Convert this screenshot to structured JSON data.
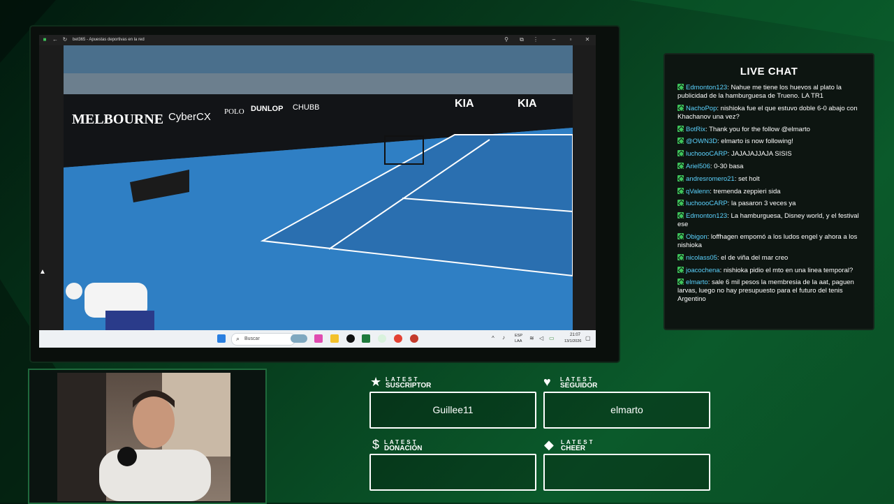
{
  "browser": {
    "title": "bet365 - Apuestas deportivas en la red"
  },
  "video": {
    "ads": [
      "MELBOURNE",
      "CyberCX",
      "POLO",
      "DUNLOP",
      "CHUBB",
      "KIA",
      "KIA"
    ]
  },
  "taskbar": {
    "search_placeholder": "Buscar",
    "lang": "ESP",
    "lang_sub": "LAA",
    "time": "21:07",
    "date": "13/1/2026"
  },
  "chat": {
    "title": "LIVE CHAT",
    "messages": [
      {
        "user": "Edmonton123",
        "text": "Nahue me tiene los huevos al plato la publicidad de la hamburguesa de Trueno. LA TR1"
      },
      {
        "user": "NachoPop",
        "text": "nishioka fue el que estuvo doble 6-0 abajo con Khachanov una vez?"
      },
      {
        "user": "BotRix",
        "text": "Thank you for the follow @elmarto"
      },
      {
        "user": "@OWN3D",
        "text": "elmarto is now following!"
      },
      {
        "user": "luchoooCARP",
        "text": "JAJAJAJJAJA SISIS"
      },
      {
        "user": "Ariel506",
        "text": "0-30 basa"
      },
      {
        "user": "andresromero21",
        "text": "set holt"
      },
      {
        "user": "qValenn",
        "text": "tremenda zeppieri sida"
      },
      {
        "user": "luchoooCARP",
        "text": "la pasaron 3 veces ya"
      },
      {
        "user": "Edmonton123",
        "text": "La hamburguesa, Disney world, y el festival ese"
      },
      {
        "user": "Obigon",
        "text": "loffhagen empomó a los ludos engel y ahora a los nishioka"
      },
      {
        "user": "nicolass05",
        "text": "el de viña del mar creo"
      },
      {
        "user": "joacochena",
        "text": "nishioka pidio el mto en una linea temporal?"
      },
      {
        "user": "elmarto",
        "text": "sale 6 mil pesos la membresia de la aat, paguen larvas, luego no hay presupuesto para el futuro del tenis Argentino"
      }
    ]
  },
  "alerts": {
    "subscriber": {
      "small": "LATEST",
      "big": "SUSCRIPTOR",
      "value": "Guillee11"
    },
    "follower": {
      "small": "LATEST",
      "big": "SEGUIDOR",
      "value": "elmarto"
    },
    "donation": {
      "small": "LATEST",
      "big": "DONACIÓN",
      "value": ""
    },
    "cheer": {
      "small": "LATEST",
      "big": "CHEER",
      "value": ""
    }
  },
  "colors": {
    "accent_green": "#3ec45a",
    "chat_user": "#5cd3ff",
    "court_blue": "#2f7fc4"
  }
}
